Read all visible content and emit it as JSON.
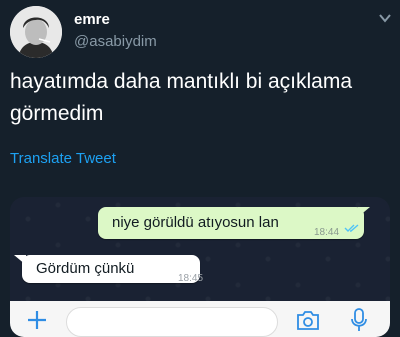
{
  "tweet": {
    "display_name": "emre",
    "handle": "@asabiydim",
    "text_line1": "hayatımda daha mantıklı bi açıklama",
    "text_line2": "görmedim",
    "translate_label": "Translate Tweet"
  },
  "chat": {
    "messages": [
      {
        "direction": "outgoing",
        "text": "niye görüldü atıyosun lan",
        "time": "18:44"
      },
      {
        "direction": "incoming",
        "text": "Gördüm çünkü",
        "time": "18:45"
      }
    ]
  },
  "icons": {
    "caret": "chevron-down-icon",
    "read_receipt": "double-check-icon",
    "attach": "plus-icon",
    "camera": "camera-icon",
    "mic": "mic-icon"
  },
  "colors": {
    "background": "#15202b",
    "link": "#1da1f2",
    "outgoing_bubble": "#dcf8c6",
    "incoming_bubble": "#ffffff",
    "read_ticks": "#4fc3f7"
  }
}
